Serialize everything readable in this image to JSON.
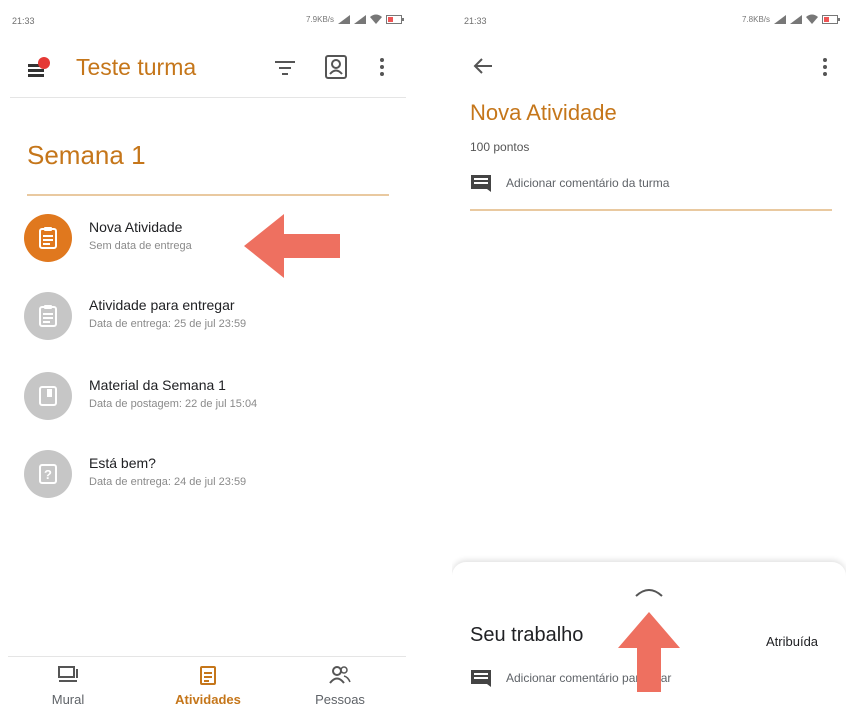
{
  "colors": {
    "accent": "#c5761a",
    "active_circle": "#e0781e",
    "inactive_circle": "#c6c6c6",
    "arrow": "#ee7060"
  },
  "left": {
    "status": {
      "time": "21:33",
      "speed": "7.9KB/s"
    },
    "header": {
      "title": "Teste turma"
    },
    "week": {
      "title": "Semana 1"
    },
    "items": [
      {
        "title": "Nova Atividade",
        "subtitle": "Sem data de entrega",
        "icon": "assignment-icon",
        "active": true
      },
      {
        "title": "Atividade para entregar",
        "subtitle": "Data de entrega: 25 de jul 23:59",
        "icon": "assignment-icon",
        "active": false
      },
      {
        "title": "Material da Semana 1",
        "subtitle": "Data de postagem: 22 de jul 15:04",
        "icon": "book-icon",
        "active": false
      },
      {
        "title": "Está bem?",
        "subtitle": "Data de entrega: 24 de jul 23:59",
        "icon": "question-icon",
        "active": false
      }
    ],
    "nav": [
      {
        "label": "Mural",
        "icon": "stream-icon"
      },
      {
        "label": "Atividades",
        "icon": "classwork-icon",
        "active": true
      },
      {
        "label": "Pessoas",
        "icon": "people-icon"
      }
    ]
  },
  "right": {
    "status": {
      "time": "21:33",
      "speed": "7.8KB/s"
    },
    "assignment": {
      "title": "Nova Atividade",
      "points": "100 pontos",
      "class_comment": "Adicionar comentário da turma"
    },
    "sheet": {
      "title": "Seu trabalho",
      "status": "Atribuída",
      "private_comment": "Adicionar comentário particular"
    }
  }
}
